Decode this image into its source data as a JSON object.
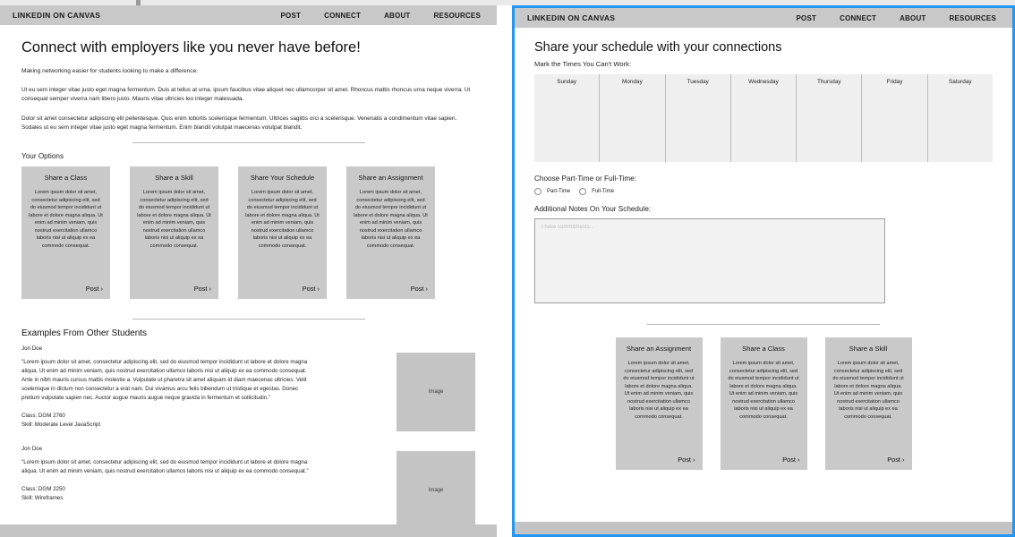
{
  "nav": {
    "brand": "LINKEDIN ON CANVAS",
    "links": [
      "POST",
      "CONNECT",
      "ABOUT",
      "RESOURCES"
    ]
  },
  "left_panel": {
    "title": "Connect with employers like you never have before!",
    "lede": "Making networking easier for students looking to make a difference.",
    "paragraphs": [
      "Ut eu sem integer vitae justo eget magna fermentum. Duis at tellus at urna. ipsum faucibus vitae aliquet nec ullamcorper sit amet. Rhoncus mattis rhoncus urna neque viverra. Ut consequat semper viverra nam libero justo. Mauris vitae ultricies leo integer malesuada.",
      "Dolor sit amet consectetur adipiscing elit pellentesque. Quis enim lobortis scelerisque fermentum. Ultrices sagittis orci a scelerisque. Venenatis a condimentum vitae sapien. Sodales ut eu sem integer vitae justo eget magna fermentum. Enim blandit volutpat maecenas volutpat blandit."
    ],
    "options_label": "Your Options",
    "cards": [
      {
        "title": "Share a Class",
        "body": "Lorem ipsum dolor sit amet, consectetur adipiscing elit, sed do eiusmod tempor incididunt ut labore et dolore magna aliqua. Ut enim ad minim veniam, quis nostrud exercitation ullamco laboris nisi ut aliquip ex ea commodo consequat.",
        "post": "Post ›"
      },
      {
        "title": "Share a Skill",
        "body": "Lorem ipsum dolor sit amet, consectetur adipiscing elit, sed do eiusmod tempor incididunt ut labore et dolore magna aliqua. Ut enim ad minim veniam, quis nostrud exercitation ullamco laboris nisi ut aliquip ex ea commodo consequat.",
        "post": "Post ›"
      },
      {
        "title": "Share Your Schedule",
        "body": "Lorem ipsum dolor sit amet, consectetur adipiscing elit, sed do eiusmod tempor incididunt ut labore et dolore magna aliqua. Ut enim ad minim veniam, quis nostrud exercitation ullamco laboris nisi ut aliquip ex ea commodo consequat.",
        "post": "Post ›"
      },
      {
        "title": "Share an Assignment",
        "body": "Lorem ipsum dolor sit amet, consectetur adipiscing elit, sed do eiusmod tempor incididunt ut labore et dolore magna aliqua. Ut enim ad minim veniam, quis nostrud exercitation ullamco laboris nisi ut aliquip ex ea commodo consequat.",
        "post": "Post ›"
      }
    ],
    "examples_heading": "Examples From Other Students",
    "examples": [
      {
        "name": "Jon Doe",
        "quote": "\"Lorem ipsum dolor sit amet, consectetur adipiscing elit, sed do eiusmod tempor incididunt ut labore et dolore magna aliqua. Ut enim ad minim veniam, quis nostrud exercitation ullamco laboris nisi ut aliquip ex ea commodo consequat. Ante in nibh mauris cursus mattis molestie a. Vulputate ut pharetra sit amet aliquam id diam maecenas ultricies. Velit scelerisque in dictum non consectetur a erat nam. Dui vivamus arcu felis bibendum ut tristique et egestas. Donec pretium vulputate sapien nec. Auctor augue mauris augue neque gravida in fermentum et sollicitudin.\"",
        "class_line": "Class: DGM 2760",
        "skill_line": "Skill: Moderate Level JavaScript",
        "image_label": "Image"
      },
      {
        "name": "Jon Doe",
        "quote": "\"Lorem ipsum dolor sit amet, consectetur adipiscing elit, sed do eiusmod tempor incididunt ut labore et dolore magna aliqua. Ut enim ad minim veniam, quis nostrud exercitation ullamco laboris nisi ut aliquip ex ea commodo consequat.\"",
        "class_line": "Class: DGM 2250",
        "skill_line": "Skill: Wireframes",
        "image_label": "Image"
      }
    ]
  },
  "right_panel": {
    "title": "Share your schedule with your connections",
    "calendar_label": "Mark the Times You Can't Work:",
    "days": [
      "Sunday",
      "Monday",
      "Tuesday",
      "Wednesday",
      "Thursday",
      "Friday",
      "Saturday"
    ],
    "employment_label": "Choose Part-Time or Full-Time:",
    "employment_options": [
      "Part-Time",
      "Full-Time"
    ],
    "notes_label": "Additional Notes On Your Schedule:",
    "notes_placeholder": "I have commitments...",
    "notes_value": "",
    "cards": [
      {
        "title": "Share an Assignment",
        "body": "Lorem ipsum dolor sit amet, consectetur adipiscing elit, sed do eiusmod tempor incididunt ut labore et dolore magna aliqua. Ut enim ad minim veniam, quis nostrud exercitation ullamco laboris nisi ut aliquip ex ea commodo consequat.",
        "post": "Post ›"
      },
      {
        "title": "Share a Class",
        "body": "Lorem ipsum dolor sit amet, consectetur adipiscing elit, sed do eiusmod tempor incididunt ut labore et dolore magna aliqua. Ut enim ad minim veniam, quis nostrud exercitation ullamco laboris nisi ut aliquip ex ea commodo consequat.",
        "post": "Post ›"
      },
      {
        "title": "Share a Skill",
        "body": "Lorem ipsum dolor sit amet, consectetur adipiscing elit, sed do eiusmod tempor incididunt ut labore et dolore magna aliqua. Ut enim ad minim veniam, quis nostrud exercitation ullamco laboris nisi ut aliquip ex ea commodo consequat.",
        "post": "Post ›"
      }
    ]
  },
  "colors": {
    "selection_border": "#2196f3",
    "navbar": "#c8c8c8",
    "card": "#c9c9c9",
    "calendar": "#efefef",
    "footer": "#c3c3c3"
  }
}
